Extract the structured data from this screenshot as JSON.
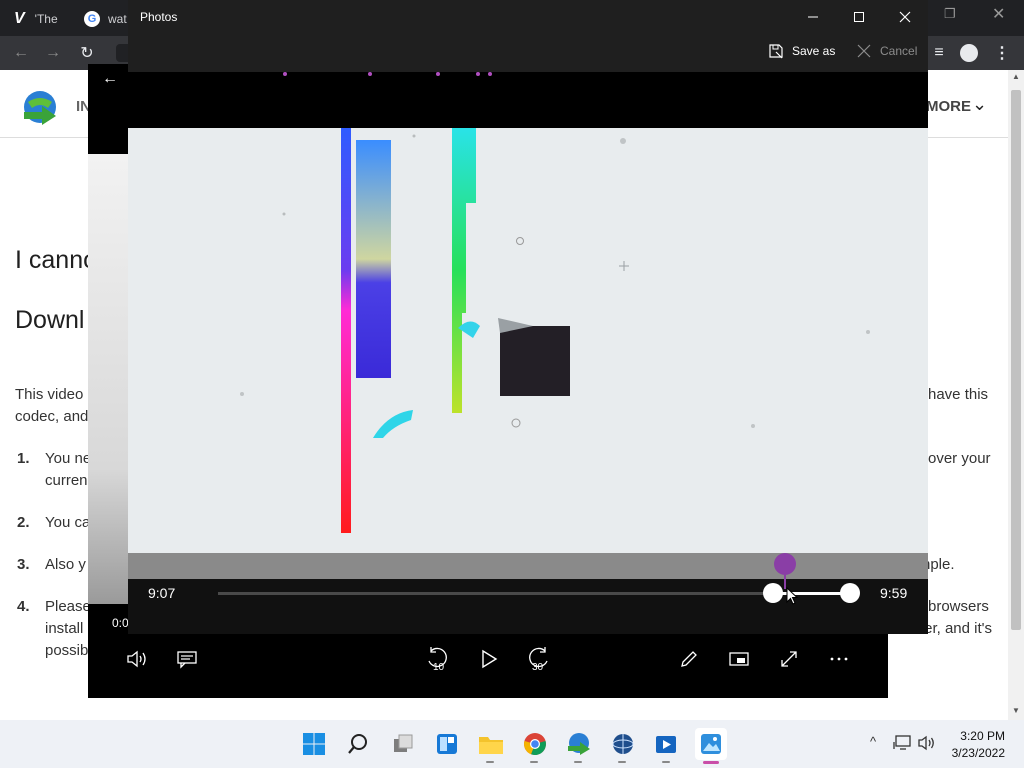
{
  "browser": {
    "tabs": [
      {
        "label": "'The"
      },
      {
        "label": "wat"
      }
    ]
  },
  "page": {
    "site_label": "IN",
    "more_label": "MORE",
    "heading1": "I canno",
    "heading2": "Downl",
    "para1_left": "This video",
    "para1_right": "have this",
    "para1_left2": "codec, and",
    "list": [
      {
        "num": "1.",
        "left": "You ne",
        "left2": "curren",
        "right": "over your"
      },
      {
        "num": "2.",
        "left": "You ca"
      },
      {
        "num": "3.",
        "left": "Also y",
        "right": "nple."
      },
      {
        "num": "4.",
        "left": "Please",
        "left2": "install",
        "left3": "possib",
        "right": "browsers",
        "right2": "owser, and it's"
      }
    ],
    "under_time": "0:0"
  },
  "photos": {
    "title": "Photos",
    "save_as": "Save as",
    "cancel": "Cancel",
    "start_time": "9:07",
    "end_time": "9:59"
  },
  "taskbar": {
    "time": "3:20 PM",
    "date": "3/23/2022"
  },
  "colors": {
    "accent_purple": "#8a3ea6",
    "taskbar_bg": "#eef1f6",
    "titlebar": "#1f1f1f"
  },
  "icons": {
    "volume": "volume-icon",
    "subtitles": "subtitles-icon",
    "rewind": "rewind-10-icon",
    "play": "play-icon",
    "forward": "forward-30-icon",
    "edit": "pencil-icon",
    "miniview": "miniview-icon",
    "fullscreen": "fullscreen-icon",
    "more": "more-icon"
  },
  "controls": {
    "rewind_label": "10",
    "forward_label": "30"
  }
}
